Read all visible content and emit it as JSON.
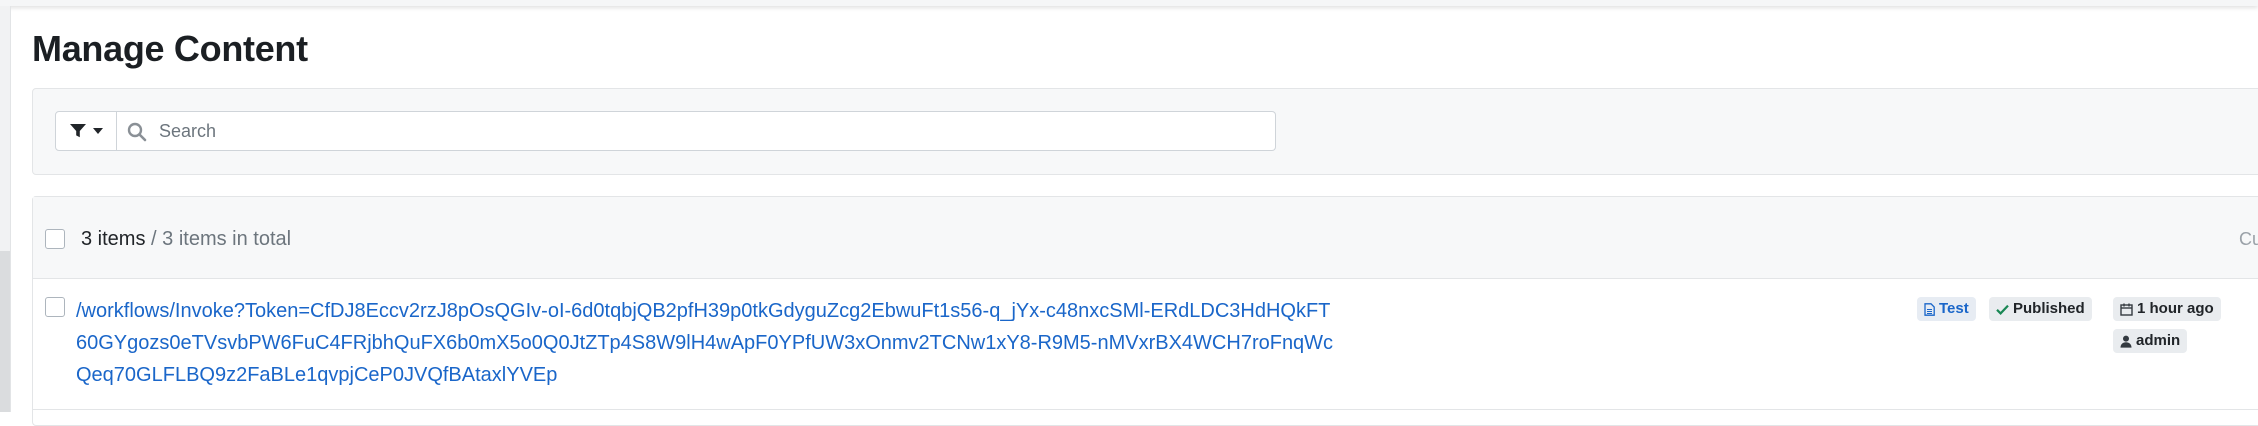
{
  "page": {
    "title": "Manage Content"
  },
  "filter": {
    "filter_icon": "filter-icon",
    "dropdown_icon": "caret-down-icon",
    "search_icon": "search-icon",
    "search_placeholder": "Search",
    "search_value": ""
  },
  "list": {
    "summary_count": "3 items",
    "summary_total": " / 3 items in total",
    "header_right_text": "Cu",
    "items": [
      {
        "link_text": "/workflows/Invoke?Token=CfDJ8Eccv2rzJ8pOsQGIv-oI-6d0tqbjQB2pfH39p0tkGdyguZcg2EbwuFt1s56-q_jYx-c48nxcSMl-ERdLDC3HdHQkFT60GYgozs0eTVsvbPW6FuC4FRjbhQuFX6b0mX5o0Q0JtZTp4S8W9lH4wApF0YPfUW3xOnmv2TCNw1xY8-R9M5-nMVxrBX4WCH7roFnqWcQeq70GLFLBQ9z2FaBLe1qvpjCeP0JVQfBAtaxlYVEp",
        "type_badge": "Test",
        "type_icon": "file-icon",
        "status_badge": "Published",
        "status_icon": "check-icon",
        "modified_badge": "1 hour ago",
        "modified_icon": "calendar-icon",
        "owner_badge": "admin",
        "owner_icon": "user-icon"
      }
    ]
  },
  "colors": {
    "link": "#1a66c9",
    "text": "#212529",
    "muted": "#6c757d",
    "panel_bg": "#f7f8f9",
    "border": "#e3e5e7"
  }
}
